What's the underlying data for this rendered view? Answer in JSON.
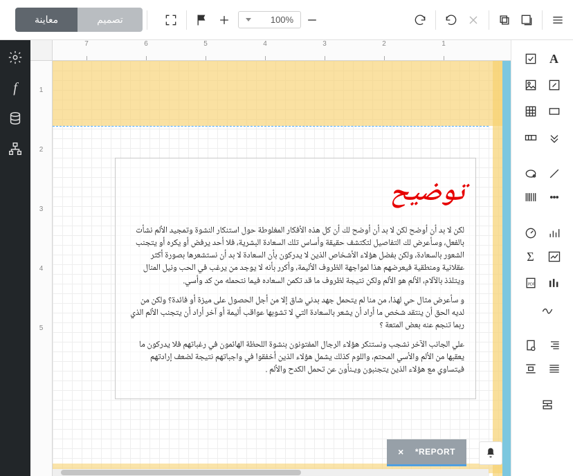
{
  "top": {
    "tabs": {
      "preview": "معاينة",
      "design": "تصميم"
    },
    "zoom": "100%"
  },
  "rulers": {
    "h": [
      "7",
      "6",
      "5",
      "4",
      "3",
      "2",
      "1"
    ],
    "v": [
      "1",
      "2",
      "3",
      "4",
      "5"
    ]
  },
  "band_label": "topMarginBand",
  "report": {
    "title": "توضيح",
    "p1": "لكن لا بد أن أوضح لكن لا بد أن أوضح لك أن كل هذه الأفكار المغلوطة حول استنكار  النشوة وتمجيد الألم نشأت بالفعل، وسأعرض لك التفاصيل لتكتشف حقيقة وأساس تلك السعادة البشرية، فلا أحد يرفض أو يكره أو يتجنب الشعور بالسعادة، ولكن بفضل هؤلاء الأشخاص الذين لا يدركون بأن السعادة لا بد أن نستشعرها بصورة أكثر عقلانية ومنطقية فيعرضهم هذا لمواجهة الظروف الأليمة، وأكرر بأنه لا يوجد من يرغب في الحب ونيل المنال ويتلذذ بالآلام، الألم هو الألم ولكن نتيجة لظروف ما قد تكمن السعاده فيما نتحمله من كد وأسي.",
    "p2": "و سأعرض مثال حي لهذا، من منا لم يتحمل جهد بدني شاق إلا من أجل الحصول على ميزة أو فائدة؟ ولكن من لديه الحق أن ينتقد شخص ما أراد أن يشعر بالسعادة التي لا تشوبها عواقب أليمة أو آخر أراد أن يتجنب الألم الذي ربما تنجم عنه بعض المتعة ؟",
    "p3": "علي الجانب الآخر نشجب ونستنكر هؤلاء الرجال المفتونون بنشوة اللحظة الهائمون في رغباتهم فلا يدركون ما يعقبها من الألم والأسي المحتم، واللوم كذلك يشمل هؤلاء الذين أخفقوا في واجباتهم نتيجة لضعف إرادتهم فيتساوي مع هؤلاء الذين يتجنبون ويـنأون عن تحمل الكدح والألم ."
  },
  "status": {
    "tab": "*REPORT"
  }
}
